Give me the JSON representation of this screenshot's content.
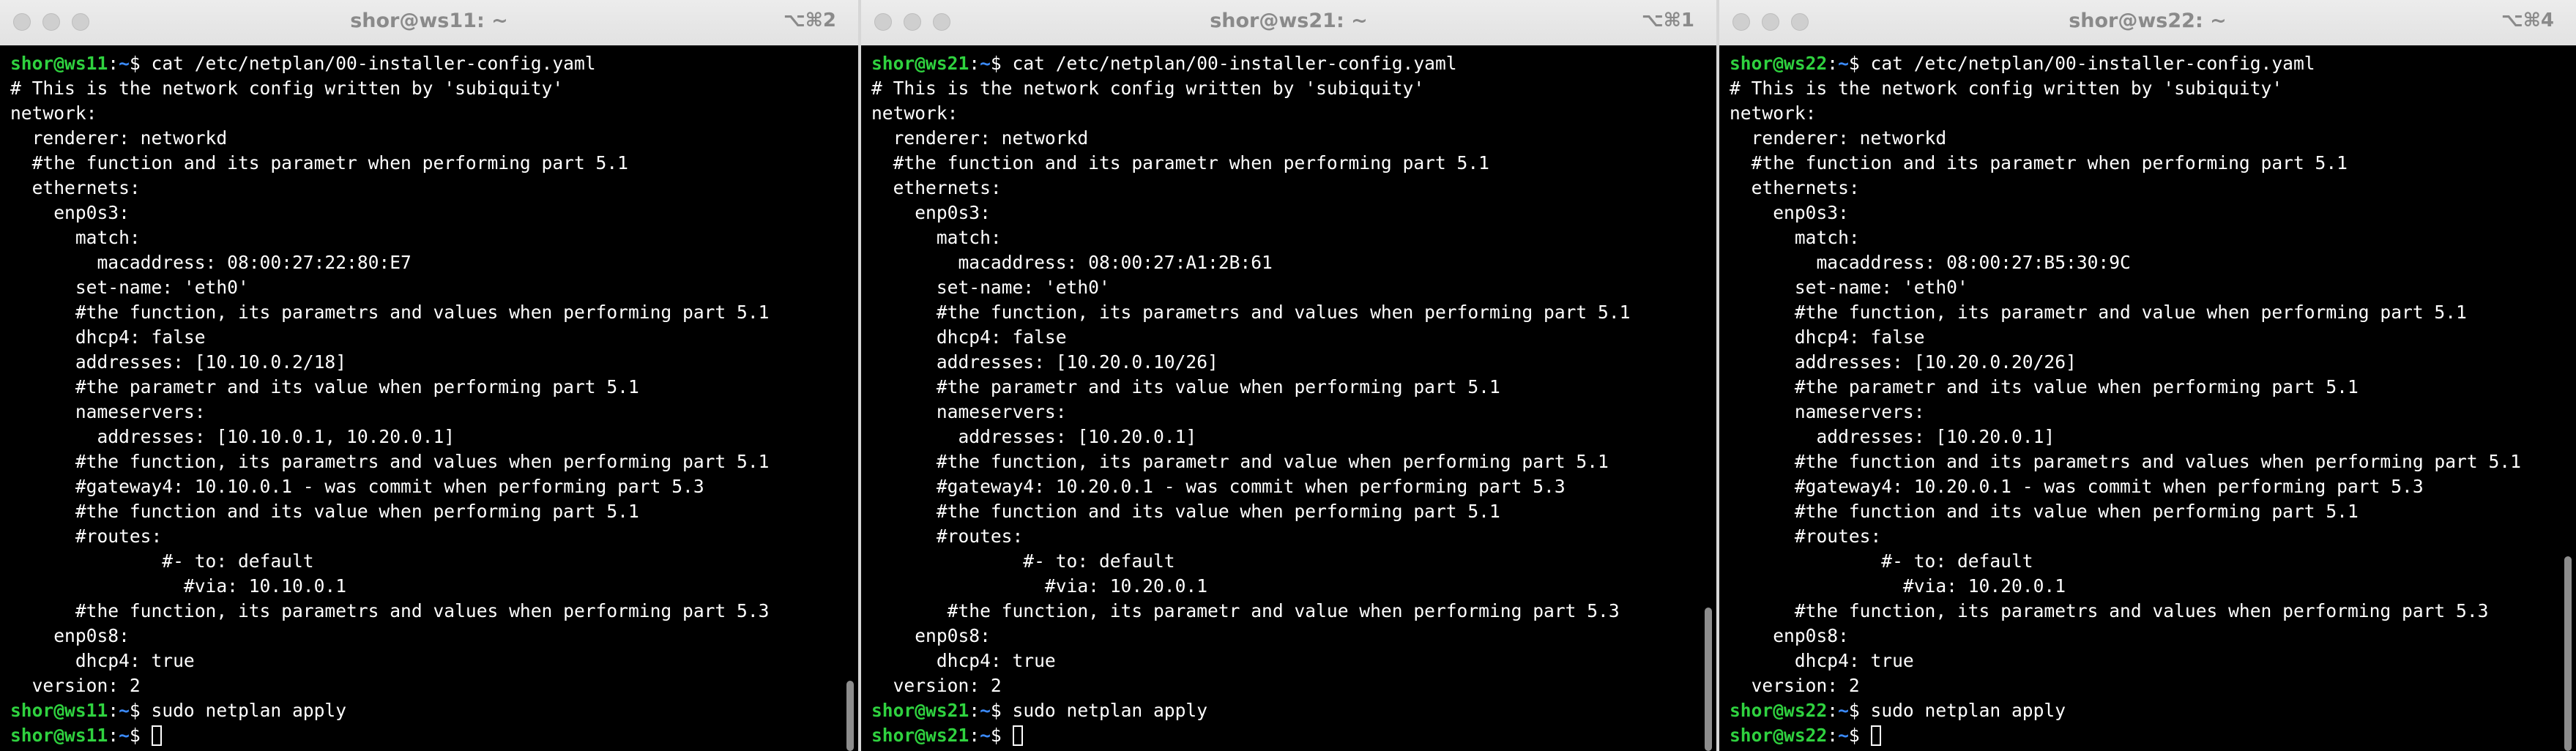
{
  "windows": [
    {
      "title": "shor@ws11: ~",
      "shortcut": "⌥⌘2",
      "prompt": {
        "user": "shor@ws11",
        "sep": ":",
        "path": "~",
        "sym": "$ "
      },
      "command": "cat /etc/netplan/00-installer-config.yaml",
      "output": [
        "# This is the network config written by 'subiquity'",
        "network:",
        "  renderer: networkd",
        "  #the function and its parametr when performing part 5.1",
        "  ethernets:",
        "    enp0s3:",
        "      match:",
        "        macaddress: 08:00:27:22:80:E7",
        "      set-name: 'eth0'",
        "      #the function, its parametrs and values when performing part 5.1",
        "      dhcp4: false",
        "      addresses: [10.10.0.2/18]",
        "      #the parametr and its value when performing part 5.1",
        "      nameservers:",
        "        addresses: [10.10.0.1, 10.20.0.1]",
        "      #the function, its parametrs and values when performing part 5.1",
        "      #gateway4: 10.10.0.1 - was commit when performing part 5.3",
        "      #the function and its value when performing part 5.1",
        "      #routes:",
        "              #- to: default",
        "                #via: 10.10.0.1",
        "      #the function, its parametrs and values when performing part 5.3",
        "    enp0s8:",
        "      dhcp4: true",
        "  version: 2"
      ],
      "command2": "sudo netplan apply"
    },
    {
      "title": "shor@ws21: ~",
      "shortcut": "⌥⌘1",
      "prompt": {
        "user": "shor@ws21",
        "sep": ":",
        "path": "~",
        "sym": "$ "
      },
      "command": "cat /etc/netplan/00-installer-config.yaml",
      "output": [
        "# This is the network config written by 'subiquity'",
        "network:",
        "  renderer: networkd",
        "  #the function and its parametr when performing part 5.1",
        "  ethernets:",
        "    enp0s3:",
        "      match:",
        "        macaddress: 08:00:27:A1:2B:61",
        "      set-name: 'eth0'",
        "      #the function, its parametrs and values when performing part 5.1",
        "      dhcp4: false",
        "      addresses: [10.20.0.10/26]",
        "      #the parametr and its value when performing part 5.1",
        "      nameservers:",
        "        addresses: [10.20.0.1]",
        "      #the function, its parametr and value when performing part 5.1",
        "      #gateway4: 10.20.0.1 - was commit when performing part 5.3",
        "      #the function and its value when performing part 5.1",
        "      #routes:",
        "              #- to: default",
        "                #via: 10.20.0.1",
        "       #the function, its parametr and value when performing part 5.3",
        "    enp0s8:",
        "      dhcp4: true",
        "  version: 2"
      ],
      "command2": "sudo netplan apply"
    },
    {
      "title": "shor@ws22: ~",
      "shortcut": "⌥⌘4",
      "prompt": {
        "user": "shor@ws22",
        "sep": ":",
        "path": "~",
        "sym": "$ "
      },
      "command": "cat /etc/netplan/00-installer-config.yaml",
      "output": [
        "# This is the network config written by 'subiquity'",
        "network:",
        "  renderer: networkd",
        "  #the function and its parametr when performing part 5.1",
        "  ethernets:",
        "    enp0s3:",
        "      match:",
        "        macaddress: 08:00:27:B5:30:9C",
        "      set-name: 'eth0'",
        "      #the function, its parametr and value when performing part 5.1",
        "      dhcp4: false",
        "      addresses: [10.20.0.20/26]",
        "      #the parametr and its value when performing part 5.1",
        "      nameservers:",
        "        addresses: [10.20.0.1]",
        "      #the function and its parametrs and values when performing part 5.1",
        "      #gateway4: 10.20.0.1 - was commit when performing part 5.3",
        "      #the function and its value when performing part 5.1",
        "      #routes:",
        "              #- to: default",
        "                #via: 10.20.0.1",
        "      #the function, its parametrs and values when performing part 5.3",
        "    enp0s8:",
        "      dhcp4: true",
        "  version: 2"
      ],
      "command2": "sudo netplan apply"
    }
  ]
}
